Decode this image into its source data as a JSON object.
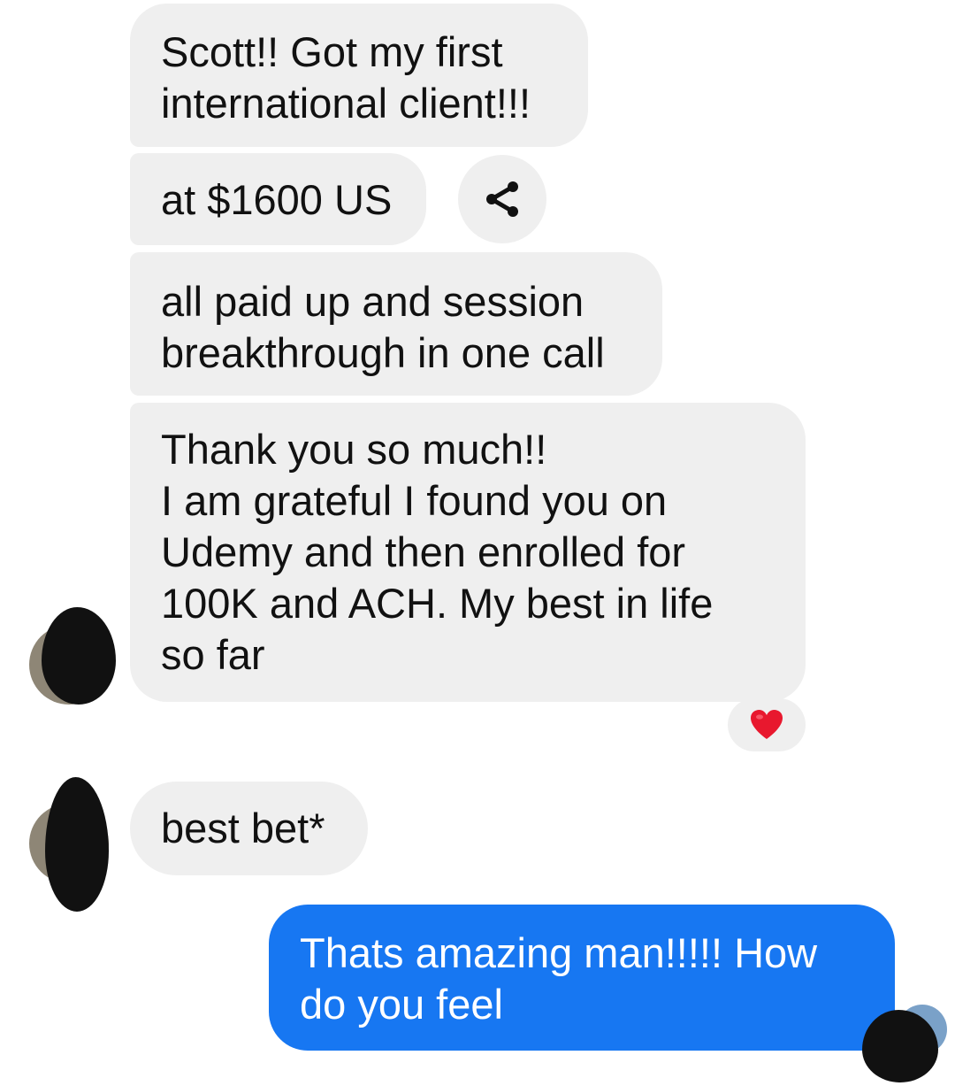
{
  "messages": [
    {
      "id": "m1",
      "direction": "incoming",
      "text": "Scott!! Got my first\ninternational client!!!"
    },
    {
      "id": "m2",
      "direction": "incoming",
      "text": "at $1600 US"
    },
    {
      "id": "m3",
      "direction": "incoming",
      "text": "all paid up and session\nbreakthrough in one call"
    },
    {
      "id": "m4",
      "direction": "incoming",
      "text": "Thank you so much!!\nI am grateful I found you on\nUdemy and then enrolled for\n100K and ACH. My best in life\nso far",
      "reaction": "heart-icon"
    },
    {
      "id": "m5",
      "direction": "incoming",
      "text": "best bet*"
    },
    {
      "id": "m6",
      "direction": "outgoing",
      "text": "Thats amazing man!!!!! How\ndo you feel"
    }
  ],
  "icons": {
    "share": "share-icon",
    "reaction": "heart-icon"
  },
  "colors": {
    "incoming_bubble": "#efefef",
    "outgoing_bubble": "#1777f2",
    "reaction_heart": "#e8182e"
  }
}
